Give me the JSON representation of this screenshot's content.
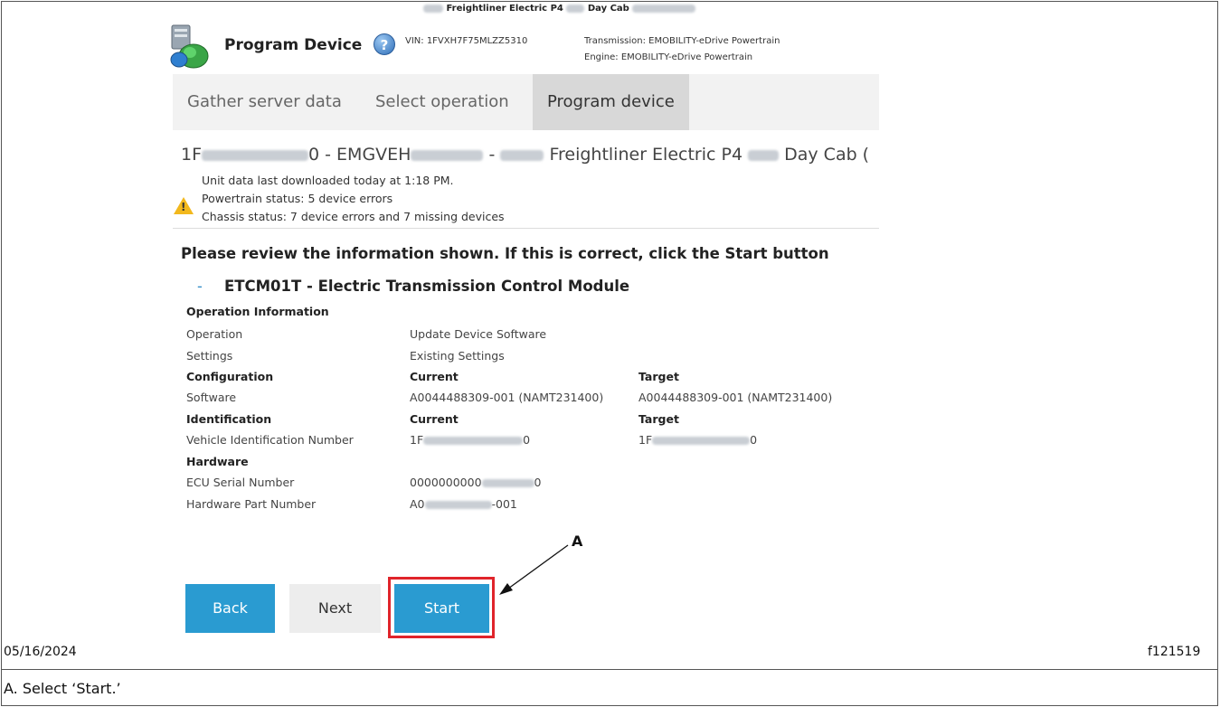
{
  "header": {
    "app_title": "Program Device",
    "vehicle_name_part1": "Freightliner Electric P4",
    "vehicle_name_part2": "Day Cab",
    "vin": "VIN: 1FVXH7F75MLZZ5310",
    "transmission": "Transmission: EMOBILITY-eDrive Powertrain",
    "engine": "Engine: EMOBILITY-eDrive Powertrain"
  },
  "tabs": [
    {
      "label": "Gather server data"
    },
    {
      "label": "Select operation"
    },
    {
      "label": "Program device"
    }
  ],
  "unit": {
    "line_part1": "1F",
    "line_part2": "0 - EMGVEH",
    "line_part3": " - ",
    "line_part4": " Freightliner Electric P4 ",
    "line_part5": " Day Cab (",
    "status_lines": [
      "Unit data last downloaded today at 1:18 PM.",
      "Powertrain status: 5 device errors",
      "Chassis status: 7 device errors and 7 missing devices"
    ]
  },
  "review_text": "Please review the information shown. If this is correct, click the Start button",
  "module": {
    "dash": "-",
    "title": "ETCM01T - Electric Transmission Control Module"
  },
  "details": {
    "operation_info_header": "Operation Information",
    "operation_label": "Operation",
    "operation_value": "Update Device Software",
    "settings_label": "Settings",
    "settings_value": "Existing Settings",
    "configuration_header": "Configuration",
    "current_header": "Current",
    "target_header": "Target",
    "software_label": "Software",
    "software_current": "A0044488309-001 (NAMT231400)",
    "software_target": "A0044488309-001 (NAMT231400)",
    "identification_header": "Identification",
    "vin_label": "Vehicle Identification Number",
    "vin_current_prefix": "1F",
    "vin_current_suffix": "0",
    "vin_target_prefix": "1F",
    "vin_target_suffix": "0",
    "hardware_header": "Hardware",
    "ecu_serial_label": "ECU Serial Number",
    "ecu_serial_prefix": "0000000000",
    "ecu_serial_suffix": "0",
    "hw_part_label": "Hardware Part Number",
    "hw_part_prefix": "A0",
    "hw_part_suffix": "-001"
  },
  "buttons": {
    "back": "Back",
    "next": "Next",
    "start": "Start"
  },
  "callout_letter": "A",
  "footer": {
    "date": "05/16/2024",
    "figure_id": "f121519",
    "caption": "A. Select ‘Start.’"
  },
  "colors": {
    "primary_button": "#2a9bd1",
    "highlight_outline": "#e0242b",
    "warning": "#f2b81d"
  }
}
